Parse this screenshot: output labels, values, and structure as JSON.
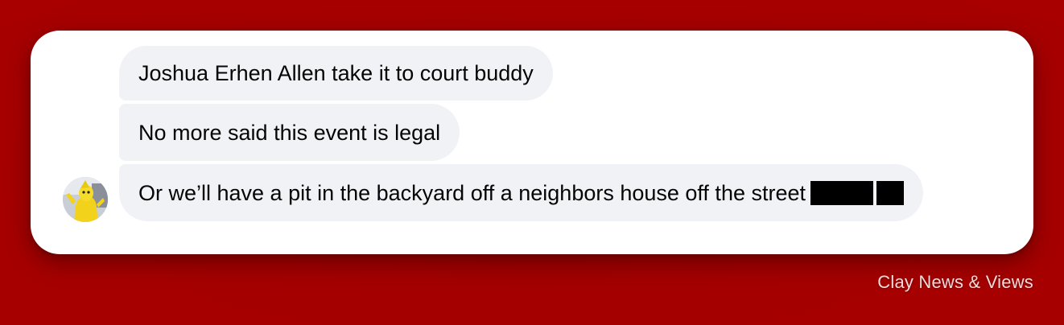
{
  "comments": [
    {
      "text": "Joshua Erhen Allen take it to court buddy"
    },
    {
      "text": "No more said this event is legal"
    },
    {
      "text": "Or we’ll have a pit in the backyard off a neighbors house off the street",
      "redacted_blocks": 2
    }
  ],
  "avatar": {
    "icon": "user-avatar-photo"
  },
  "watermark": "Clay News & Views",
  "colors": {
    "background": "#a40000",
    "card": "#ffffff",
    "bubble": "#f1f2f5",
    "text": "#050505"
  }
}
